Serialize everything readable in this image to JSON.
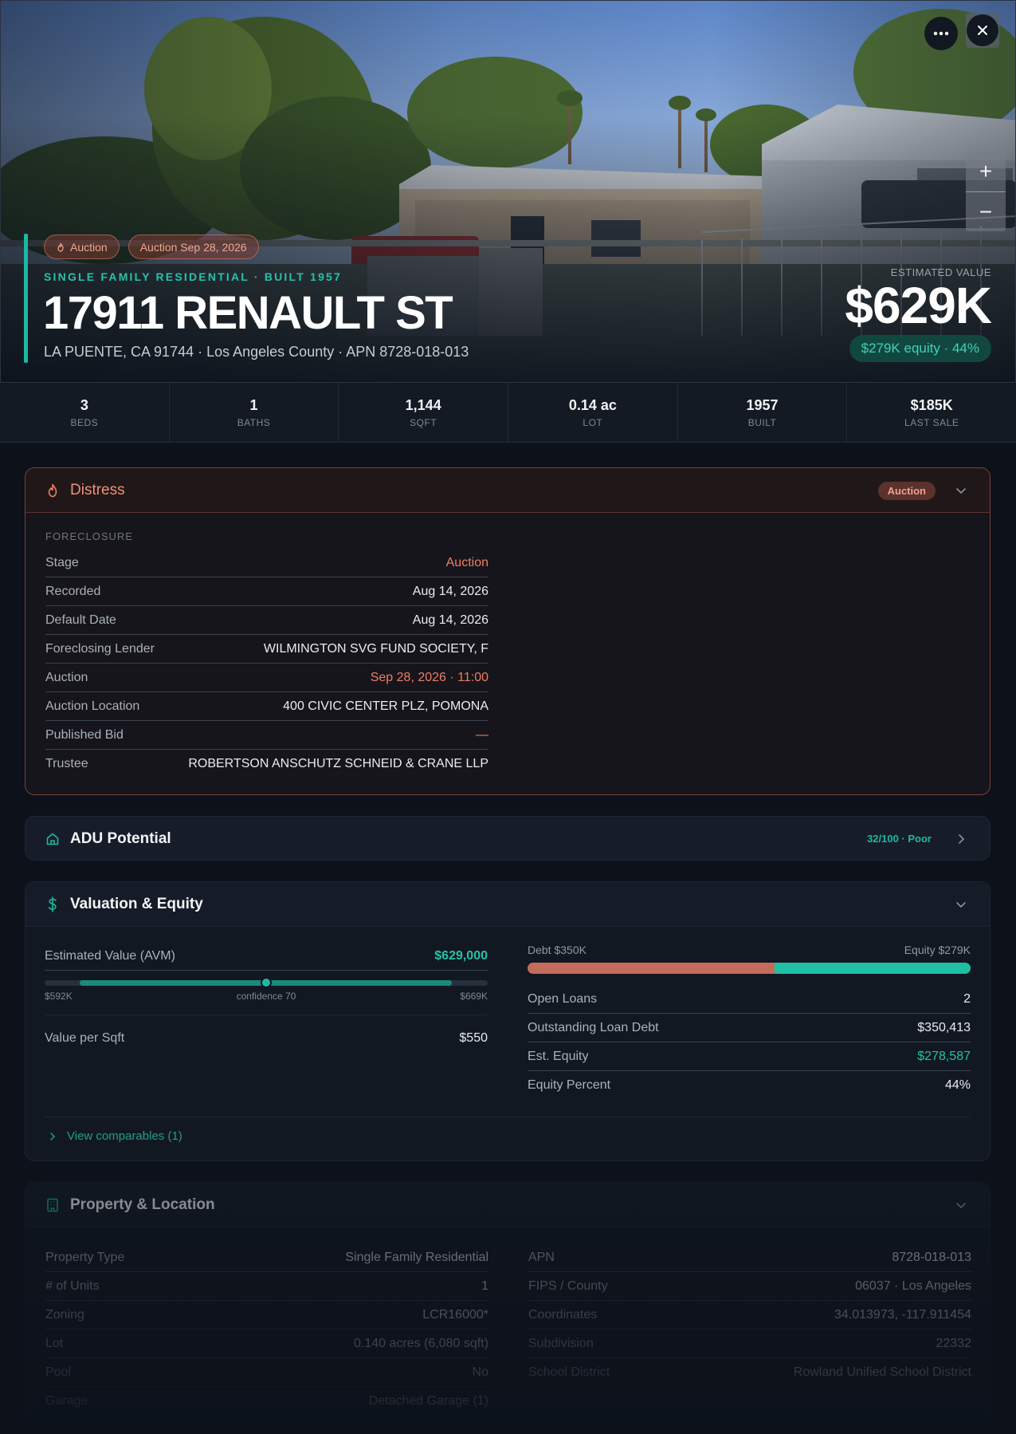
{
  "hero": {
    "badges": [
      "Auction",
      "Auction Sep 28, 2026"
    ],
    "subtitle": "SINGLE FAMILY RESIDENTIAL · BUILT 1957",
    "title": "17911 RENAULT ST",
    "address": "LA PUENTE, CA 91744 · Los Angeles County · APN 8728-018-013",
    "estimated_label": "ESTIMATED VALUE",
    "estimated_value": "$629K",
    "equity_pill": "$279K equity · 44%",
    "more_icon": "more-horizontal-icon",
    "close_icon": "close-icon",
    "zoom_in": "+",
    "zoom_out": "−"
  },
  "stats": [
    {
      "value": "3",
      "label": "BEDS"
    },
    {
      "value": "1",
      "label": "BATHS"
    },
    {
      "value": "1,144",
      "label": "SQFT"
    },
    {
      "value": "0.14 ac",
      "label": "LOT"
    },
    {
      "value": "1957",
      "label": "BUILT"
    },
    {
      "value": "$185K",
      "label": "LAST SALE"
    }
  ],
  "distress": {
    "title": "Distress",
    "pill": "Auction",
    "icon": "flame-icon",
    "section": "FORECLOSURE",
    "rows": [
      {
        "k": "Stage",
        "v": "Auction"
      },
      {
        "k": "Recorded",
        "v": "Aug 14, 2026"
      },
      {
        "k": "Default Date",
        "v": "Aug 14, 2026"
      },
      {
        "k": "Foreclosing Lender",
        "v": "WILMINGTON SVG FUND SOCIETY, F"
      },
      {
        "k": "Auction",
        "v": "Sep 28, 2026 · 11:00"
      },
      {
        "k": "Auction Location",
        "v": "400 CIVIC CENTER PLZ, POMONA"
      },
      {
        "k": "Published Bid",
        "v": "—"
      },
      {
        "k": "Trustee",
        "v": "ROBERTSON ANSCHUTZ SCHNEID & CRANE LLP"
      }
    ]
  },
  "adu": {
    "title": "ADU Potential",
    "score": "32/100 · Poor",
    "icon": "home-icon"
  },
  "valuation": {
    "title": "Valuation & Equity",
    "icon": "dollar-icon",
    "avm_label": "Estimated Value (AVM)",
    "avm_value": "$629,000",
    "range_low": "$592K",
    "range_high": "$669K",
    "confidence": "confidence 70",
    "range_position": 0.5,
    "sqft_label": "Value per Sqft",
    "sqft_value": "$550",
    "debt_label": "Debt $350K",
    "equity_label": "Equity $279K",
    "debt_fraction": 0.557,
    "rows": [
      {
        "k": "Open Loans",
        "v": "2"
      },
      {
        "k": "Outstanding Loan Debt",
        "v": "$350,413"
      },
      {
        "k": "Est. Equity",
        "v": "$278,587"
      },
      {
        "k": "Equity Percent",
        "v": "44%"
      }
    ],
    "comps_link": "View comparables (1)"
  },
  "property": {
    "title": "Property & Location",
    "icon": "building-icon",
    "left": [
      {
        "k": "Property Type",
        "v": "Single Family Residential"
      },
      {
        "k": "# of Units",
        "v": "1"
      },
      {
        "k": "Zoning",
        "v": "LCR16000*"
      },
      {
        "k": "Lot",
        "v": "0.140 acres (6,080 sqft)"
      },
      {
        "k": "Pool",
        "v": "No"
      },
      {
        "k": "Garage",
        "v": "Detached Garage (1)"
      }
    ],
    "right": [
      {
        "k": "APN",
        "v": "8728-018-013"
      },
      {
        "k": "FIPS / County",
        "v": "06037 · Los Angeles"
      },
      {
        "k": "Coordinates",
        "v": "34.013973, -117.911454"
      },
      {
        "k": "Subdivision",
        "v": "22332"
      },
      {
        "k": "School District",
        "v": "Rowland Unified School District"
      }
    ]
  }
}
